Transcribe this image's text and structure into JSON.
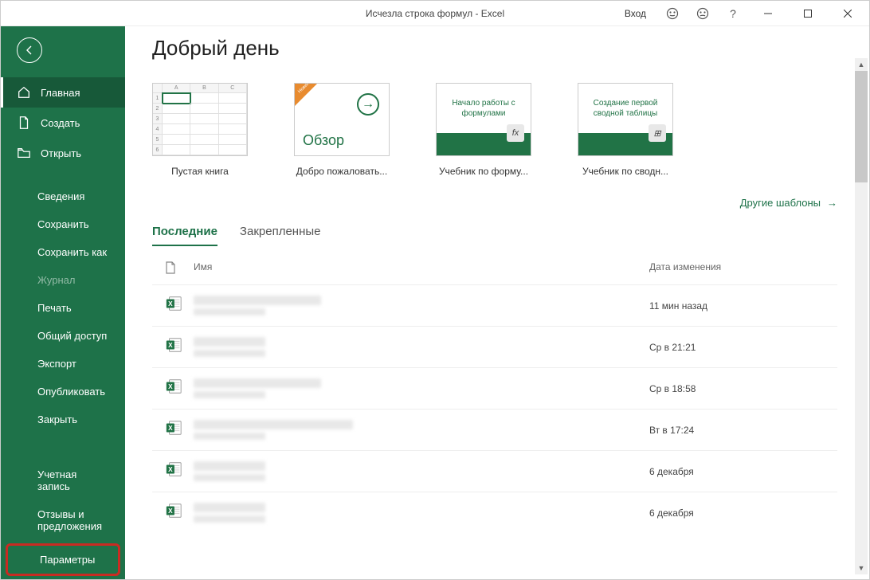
{
  "titlebar": {
    "title": "Исчезла строка формул  -  Excel",
    "signin": "Вход"
  },
  "sidebar": {
    "home": "Главная",
    "new": "Создать",
    "open": "Открыть",
    "info": "Сведения",
    "save": "Сохранить",
    "saveas": "Сохранить как",
    "history": "Журнал",
    "print": "Печать",
    "share": "Общий доступ",
    "export": "Экспорт",
    "publish": "Опубликовать",
    "close": "Закрыть",
    "account": "Учетная запись",
    "feedback": "Отзывы и предложения",
    "options": "Параметры"
  },
  "content": {
    "greeting": "Добрый день",
    "templates": [
      {
        "label": "Пустая книга"
      },
      {
        "label": "Добро пожаловать...",
        "tour_text": "Обзор",
        "badge": "Новинка"
      },
      {
        "label": "Учебник по форму...",
        "head": "Начало работы с формулами",
        "badge": "fx"
      },
      {
        "label": "Учебник по сводн...",
        "head": "Создание первой сводной таблицы",
        "badge": "⊞"
      }
    ],
    "more_templates": "Другие шаблоны",
    "tabs": {
      "recent": "Последние",
      "pinned": "Закрепленные"
    },
    "columns": {
      "name": "Имя",
      "date": "Дата изменения"
    },
    "files": [
      {
        "date": "11 мин назад"
      },
      {
        "date": "Ср в 21:21"
      },
      {
        "date": "Ср в 18:58"
      },
      {
        "date": "Вт в 17:24"
      },
      {
        "date": "6 декабря"
      },
      {
        "date": "6 декабря"
      }
    ]
  }
}
